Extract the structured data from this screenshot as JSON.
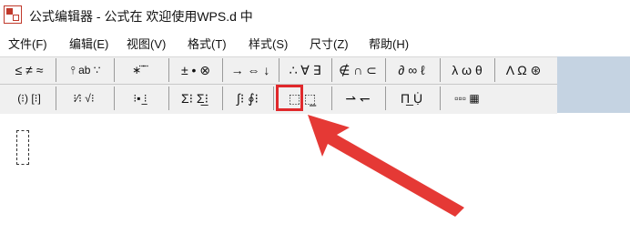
{
  "titlebar": {
    "title": "公式编辑器 - 公式在 欢迎使用WPS.d 中",
    "icon": "equation-editor-app-icon"
  },
  "menu": [
    {
      "label": "文件(F)"
    },
    {
      "label": "编辑(E)"
    },
    {
      "label": "视图(V)"
    },
    {
      "label": "格式(T)"
    },
    {
      "label": "样式(S)"
    },
    {
      "label": "尺寸(Z)"
    },
    {
      "label": "帮助(H)"
    }
  ],
  "toolbar_row1": [
    {
      "label": "≤ ≠ ≈",
      "icon": "relational-symbols-icon"
    },
    {
      "label": "⫯ ab ∵",
      "icon": "spaces-ellipses-icon"
    },
    {
      "label": "∗ ⃛ ⃛",
      "icon": "embellishments-icon"
    },
    {
      "label": "± • ⊗",
      "icon": "operator-symbols-icon"
    },
    {
      "label": "→ ⇔ ↓",
      "icon": "arrow-symbols-icon"
    },
    {
      "label": "∴ ∀ ∃",
      "icon": "logical-symbols-icon"
    },
    {
      "label": "∉ ∩ ⊂",
      "icon": "set-theory-symbols-icon"
    },
    {
      "label": "∂ ∞ ℓ",
      "icon": "misc-symbols-icon"
    },
    {
      "label": "λ ω θ",
      "icon": "greek-lowercase-icon"
    },
    {
      "label": "Λ Ω ⊛",
      "icon": "greek-uppercase-icon"
    }
  ],
  "toolbar_row2": [
    {
      "label": "(⁝) [⁝]",
      "icon": "fence-templates-icon"
    },
    {
      "label": "⁝⁄⁝ √⁝",
      "icon": "fraction-radical-templates-icon"
    },
    {
      "label": "⁝▪ ⁝̲",
      "icon": "subscript-superscript-templates-icon"
    },
    {
      "label": "Σ⁝ Σ̲⁝",
      "icon": "summation-templates-icon"
    },
    {
      "label": "∫⁝ ∮⁝",
      "icon": "integral-templates-icon"
    },
    {
      "label": "⬚ ⬚̲",
      "icon": "underbar-overbar-templates-icon"
    },
    {
      "label": "⇀ ↽",
      "icon": "labeled-arrow-templates-icon"
    },
    {
      "label": "Π̲ Ụ̇",
      "icon": "products-set-theory-templates-icon"
    },
    {
      "label": "▫▫▫ ▦",
      "icon": "matrix-templates-icon"
    }
  ],
  "accent_color": "#e0282b",
  "annotation": {
    "icon": "red-arrow-pointer-icon",
    "target": "underbar-overbar-templates"
  }
}
